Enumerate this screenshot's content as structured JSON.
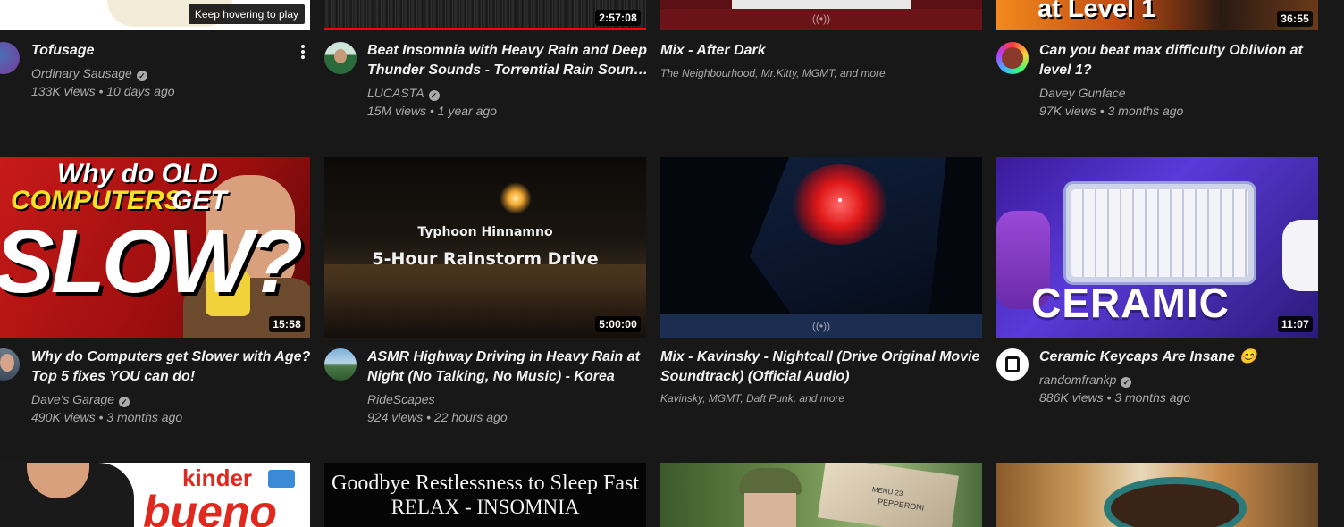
{
  "row1": [
    {
      "title_line1": "Tofusage",
      "title_line2": "",
      "channel": "Ordinary Sausage",
      "verified": true,
      "stats": "133K views • 10 days ago",
      "overlay": "Keep hovering to play"
    },
    {
      "title_line1": "Beat Insomnia with Heavy Rain and Deep",
      "title_line2": "Thunder Sounds - Torrential Rain Soun…",
      "channel": "LUCASTA",
      "verified": true,
      "stats": "15M views • 1 year ago",
      "duration": "2:57:08"
    },
    {
      "title_line1": "Mix - After Dark",
      "title_line2": "",
      "subtitle": "The Neighbourhood, Mr.Kitty, MGMT, and more"
    },
    {
      "title_line1": "Can you beat max difficulty Oblivion at",
      "title_line2": "level 1?",
      "channel": "Davey Gunface",
      "verified": false,
      "stats": "97K views • 3 months ago",
      "duration": "36:55",
      "thumb_text": "at Level 1"
    }
  ],
  "row2": [
    {
      "title_line1": "Why do Computers get Slower with Age?",
      "title_line2": "Top 5 fixes YOU can do!",
      "channel": "Dave's Garage",
      "verified": true,
      "stats": "490K views • 3 months ago",
      "duration": "15:58",
      "thumb_text1": "Why do OLD",
      "thumb_text2": "COMPUTERS",
      "thumb_text3": "GET",
      "thumb_text4": "SLOW?"
    },
    {
      "title_line1": "ASMR Highway Driving in Heavy Rain at",
      "title_line2": "Night (No Talking, No Music) - Korea",
      "channel": "RideScapes",
      "verified": false,
      "stats": "924 views • 22 hours ago",
      "duration": "5:00:00",
      "thumb_text1": "Typhoon Hinnamno",
      "thumb_text2": "5-Hour Rainstorm Drive"
    },
    {
      "title_line1": "Mix - Kavinsky - Nightcall (Drive Original Movie",
      "title_line2": "Soundtrack) (Official Audio)",
      "subtitle": "Kavinsky, MGMT, Daft Punk, and more"
    },
    {
      "title_line1": "Ceramic Keycaps Are Insane 😊",
      "title_line2": "",
      "channel": "randomfrankp",
      "verified": true,
      "stats": "886K views • 3 months ago",
      "duration": "11:07",
      "thumb_text": "CERAMIC"
    }
  ],
  "row3": [
    {
      "thumb_text1": "kinder",
      "thumb_text2": "bueno"
    },
    {
      "thumb_text1": "Goodbye Restlessness to Sleep Fast",
      "thumb_text2": "RELAX - INSOMNIA"
    },
    {
      "thumb_text1": "MENU 23",
      "thumb_text2": "PEPPERONI"
    },
    {}
  ],
  "icons": {
    "more": "more-vert-icon",
    "verified": "check-circle-icon",
    "mix": "radio-broadcast-icon"
  }
}
